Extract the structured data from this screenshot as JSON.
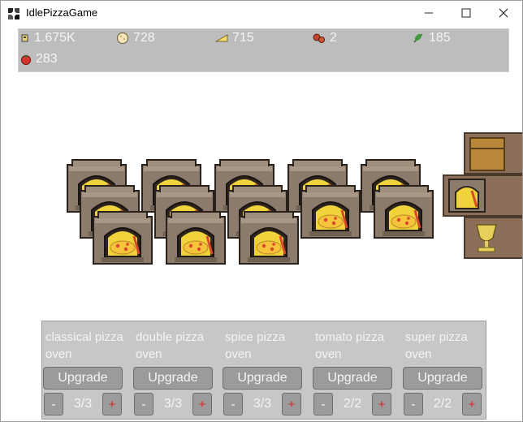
{
  "window": {
    "title": "IdlePizzaGame",
    "minimize_icon": "minimize-icon",
    "maximize_icon": "maximize-icon",
    "close_icon": "close-icon"
  },
  "resources": [
    {
      "name": "money",
      "icon": "coin-stack-icon",
      "value": "1.675K"
    },
    {
      "name": "dough",
      "icon": "dough-icon",
      "value": "728"
    },
    {
      "name": "cheese",
      "icon": "cheese-icon",
      "value": "715"
    },
    {
      "name": "meat",
      "icon": "salami-icon",
      "value": "2"
    },
    {
      "name": "herbs",
      "icon": "herb-icon",
      "value": "185"
    },
    {
      "name": "tomato",
      "icon": "tomato-icon",
      "value": "283"
    }
  ],
  "side_menu": [
    {
      "icon": "crate-icon"
    },
    {
      "icon": "oven-icon"
    },
    {
      "icon": "trophy-icon"
    }
  ],
  "ovens": [
    {
      "label": "classical pizza oven",
      "upgrade": "Upgrade",
      "minus": "-",
      "plus": "+",
      "count": "3/3",
      "units": 3
    },
    {
      "label": "double pizza oven",
      "upgrade": "Upgrade",
      "minus": "-",
      "plus": "+",
      "count": "3/3",
      "units": 3
    },
    {
      "label": "spice pizza oven",
      "upgrade": "Upgrade",
      "minus": "-",
      "plus": "+",
      "count": "3/3",
      "units": 3
    },
    {
      "label": "tomato pizza oven",
      "upgrade": "Upgrade",
      "minus": "-",
      "plus": "+",
      "count": "2/2",
      "units": 2
    },
    {
      "label": "super pizza oven",
      "upgrade": "Upgrade",
      "minus": "-",
      "plus": "+",
      "count": "2/2",
      "units": 2
    }
  ],
  "colors": {
    "oven_body": "#8a7b6c",
    "oven_dark": "#3a2e26",
    "pizza_crust": "#f2c23a",
    "pizza_sauce": "#d8482a",
    "panel_bg": "#c7c7c7",
    "button_bg": "#9b9b9b",
    "plus_color": "#e02020"
  }
}
